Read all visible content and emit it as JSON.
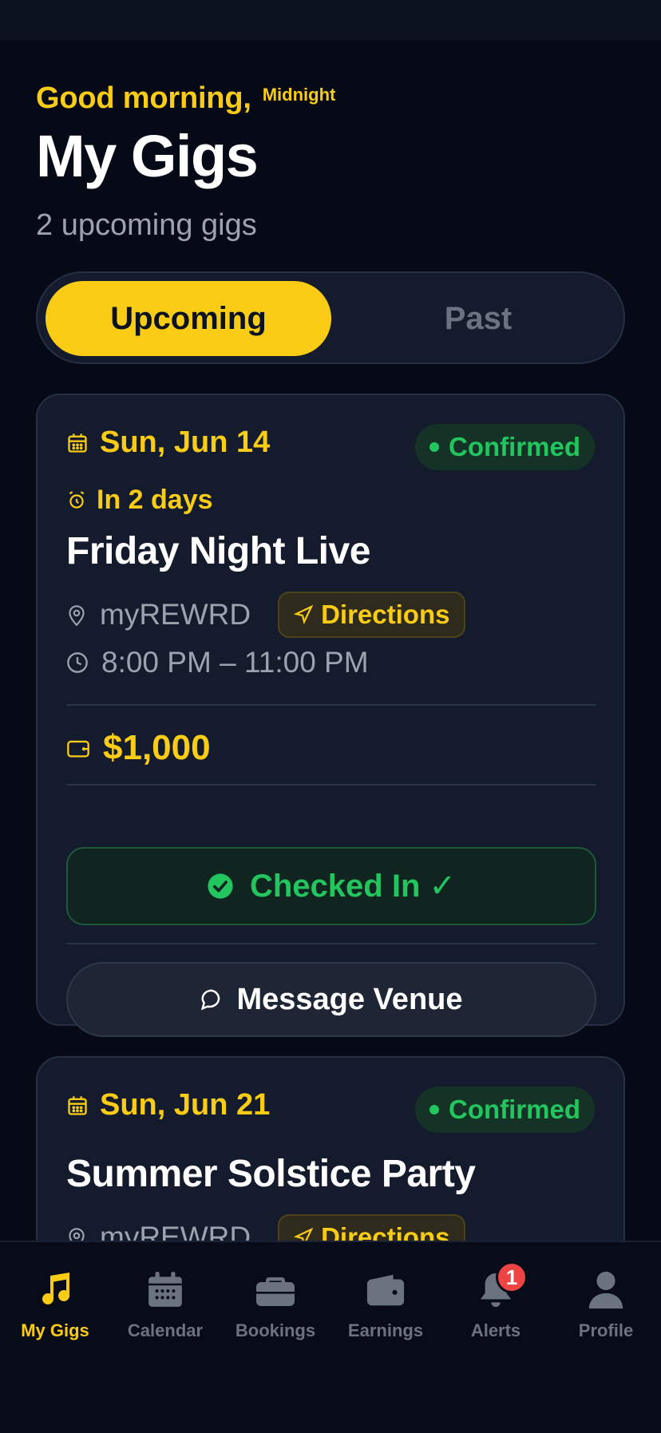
{
  "header": {
    "greeting": "Good morning,",
    "name": "Midnight",
    "title": "My Gigs",
    "subtitle": "2 upcoming gigs"
  },
  "segments": {
    "upcoming": "Upcoming",
    "past": "Past",
    "selected": "Upcoming"
  },
  "gigs": [
    {
      "date": "Sun, Jun 14",
      "status": "Confirmed",
      "countdown": "In 2 days",
      "title": "Friday Night Live",
      "venue": "myREWRD",
      "directions": "Directions",
      "time": "8:00 PM – 11:00 PM",
      "pay": "$1,000",
      "checkin": "Checked In ✓",
      "message": "Message Venue"
    },
    {
      "date": "Sun, Jun 21",
      "status": "Confirmed",
      "title": "Summer Solstice Party",
      "venue": "myREWRD",
      "directions": "Directions"
    }
  ],
  "tabbar": {
    "items": [
      {
        "label": "My Gigs",
        "icon": "music-note-icon",
        "active": true
      },
      {
        "label": "Calendar",
        "icon": "calendar-icon"
      },
      {
        "label": "Bookings",
        "icon": "briefcase-icon"
      },
      {
        "label": "Earnings",
        "icon": "wallet-icon"
      },
      {
        "label": "Alerts",
        "icon": "bell-icon",
        "badge": "1"
      },
      {
        "label": "Profile",
        "icon": "person-icon"
      }
    ]
  },
  "colors": {
    "accent": "#facc15",
    "success": "#22c55e",
    "background": "#060a17",
    "card": "#131b2d",
    "badge_red": "#ef4444"
  }
}
